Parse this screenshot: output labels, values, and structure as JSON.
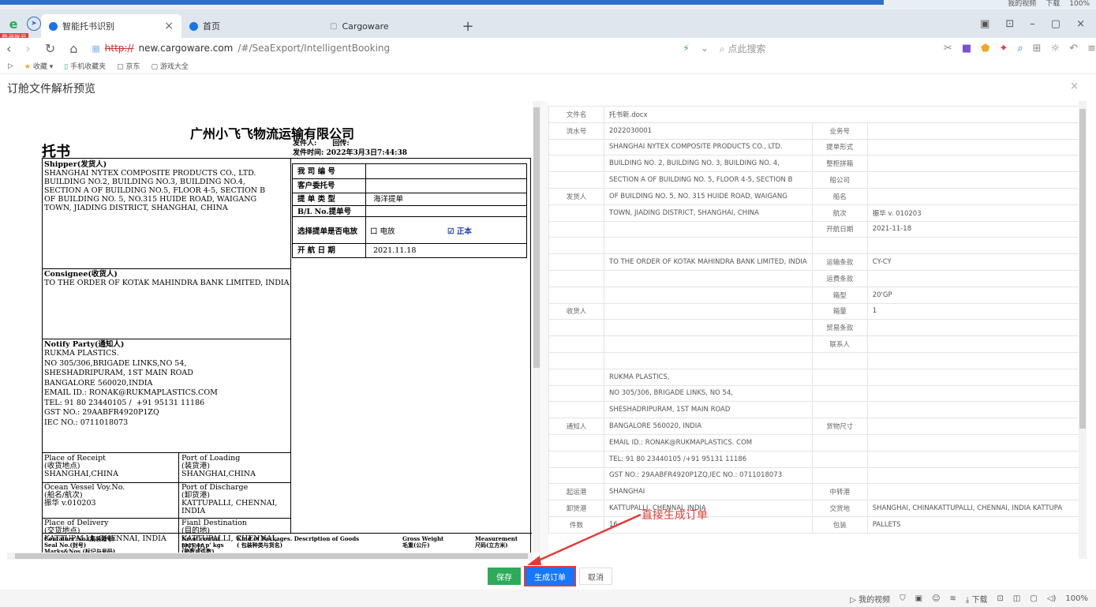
{
  "os": {
    "status_items": [
      "我的视频",
      "下载",
      "100%"
    ]
  },
  "browser": {
    "login_badge": "登录账号",
    "tabs": [
      {
        "label": "智能托书识别",
        "active": true
      },
      {
        "label": "首页",
        "active": false
      },
      {
        "label": "Cargoware",
        "active": false
      }
    ],
    "url_scheme": "http://",
    "url_host": "new.cargoware.com",
    "url_path": "/#/SeaExport/IntelligentBooking",
    "search_placeholder": "点此搜索",
    "bookmarks": [
      "收藏",
      "手机收藏夹",
      "京东",
      "游戏大全"
    ]
  },
  "dialog": {
    "title": "订舱文件解析预览",
    "buttons": {
      "save": "保存",
      "generate": "生成订单",
      "cancel": "取消"
    },
    "annotation": "直接生成订单"
  },
  "document": {
    "company": "广州小飞飞物流运输有限公司",
    "heading": "托书",
    "sender_label": "发件人:",
    "reply_label": "回传:",
    "send_time": "发件时间: 2022年3月3日7:44:38",
    "shipper_label": "Shipper(发货人)",
    "shipper_text": "SHANGHAI NYTEX COMPOSITE PRODUCTS CO., LTD.\nBUILDING NO.2, BUILDING NO.3, BUILDING NO.4,\nSECTION A OF BUILDING NO.5, FLOOR 4-5, SECTION B\nOF BUILDING NO. 5, NO.315 HUIDE ROAD, WAIGANG\nTOWN, JIADING DISTRICT, SHANGHAI, CHINA",
    "company_no": "我 司 编 号",
    "client_no": "客户委托号",
    "bl_type_label": "提 单 类 型",
    "bl_type_value": "海洋提单",
    "bl_no": "B/L No.提单号",
    "telex_label": "选择提单是否电放",
    "telex_opt1": "口 电放",
    "telex_opt2": "☑ 正本",
    "consignee_label": "Consignee(收货人)",
    "consignee_text": "TO THE ORDER OF KOTAK MAHINDRA BANK LIMITED, INDIA",
    "sail_label": "开 航 日 期",
    "sail_value": "2021.11.18",
    "notify_label": "Notify Party(通知人)",
    "notify_text": "RUKMA PLASTICS.\nNO 305/306,BRIGADE LINKS,NO 54,\nSHESHADRIPURAM, 1ST MAIN ROAD\nBANGALORE 560020,INDIA\nEMAIL ID.: RONAK@RUKMAPLASTICS.COM\nTEL: 91 80 23440105 /  +91 95131 11186\nGST NO.: 29AABFR4920P1ZQ\nIEC NO.: 0711018073",
    "receipt": "Place of Receipt\n(收货地点)\nSHANGHAI,CHINA",
    "loading": "Port of Loading\n(装货港)\nSHANGHAI,CHINA",
    "vessel": "Ocean Vessel Voy.No.\n(船名/航次)\n振华 v.010203",
    "discharge": "Port of Discharge\n(卸货港)\nKATTUPALLI, CHENNAI,\nINDIA",
    "delivery": "Place of Delivery\n(交货地点)\nKATTUPALLI, CHENNAI, INDIA",
    "final": "Fianl Destination\n(目的地)\nKATTUPALLI, CHENNAI,\nINDIA",
    "col_container": "Container No.(集装箱号)\nSeal No.(封号)\nMarks&Nos.(标记与号码)",
    "col_packages": "No of contai\nners or p' kgs\n(箱数或件数)",
    "col_kind": "Kind of Packages. Description of Goods\n( 包装种类与货名)",
    "col_weight": "Gross Weight\n毛重(公斤)",
    "col_measure": "Measurement\n尺码(立方米)"
  },
  "form": {
    "rows": [
      {
        "l": "文件名",
        "v": "托书新.docx",
        "l2": "",
        "v2": "",
        "full": true
      },
      {
        "l": "流水号",
        "v": "2022030001",
        "l2": "业务号",
        "v2": ""
      },
      {
        "l": "",
        "v": "SHANGHAI NYTEX COMPOSITE PRODUCTS CO., LTD.",
        "l2": "提单形式",
        "v2": ""
      },
      {
        "l": "",
        "v": "BUILDING NO. 2, BUILDING NO. 3, BUILDING NO. 4,",
        "l2": "整柜拼箱",
        "v2": ""
      },
      {
        "l": "",
        "v": "SECTION A OF BUILDING NO. 5, FLOOR 4-5, SECTION B",
        "l2": "船公司",
        "v2": ""
      },
      {
        "l": "发货人",
        "v": "OF BUILDING NO. 5, NO. 315 HUIDE ROAD, WAIGANG",
        "l2": "船名",
        "v2": ""
      },
      {
        "l": "",
        "v": "TOWN, JIADING DISTRICT, SHANGHAI, CHINA",
        "l2": "航次",
        "v2": "振华 v. 010203"
      },
      {
        "l": "",
        "v": "",
        "l2": "开航日期",
        "v2": "2021-11-18"
      },
      {
        "l": "",
        "v": "",
        "l2": "",
        "v2": ""
      },
      {
        "l": "",
        "v": "TO THE ORDER OF KOTAK MAHINDRA BANK LIMITED, INDIA",
        "l2": "运输条款",
        "v2": "CY-CY"
      },
      {
        "l": "",
        "v": "",
        "l2": "运费条款",
        "v2": ""
      },
      {
        "l": "",
        "v": "",
        "l2": "箱型",
        "v2": "20'GP"
      },
      {
        "l": "收货人",
        "v": "",
        "l2": "箱量",
        "v2": "1"
      },
      {
        "l": "",
        "v": "",
        "l2": "贸易条款",
        "v2": ""
      },
      {
        "l": "",
        "v": "",
        "l2": "联系人",
        "v2": ""
      },
      {
        "l": "",
        "v": "",
        "l2": "",
        "v2": ""
      },
      {
        "l": "",
        "v": "RUKMA PLASTICS,",
        "l2": "",
        "v2": ""
      },
      {
        "l": "",
        "v": "NO 305/306, BRIGADE LINKS, NO 54,",
        "l2": "",
        "v2": ""
      },
      {
        "l": "",
        "v": "SHESHADRIPURAM, 1ST MAIN ROAD",
        "l2": "",
        "v2": ""
      },
      {
        "l": "通知人",
        "v": "BANGALORE 560020, INDIA",
        "l2": "货物尺寸",
        "v2": ""
      },
      {
        "l": "",
        "v": "EMAIL ID.: RONAK@RUKMAPLASTICS. COM",
        "l2": "",
        "v2": ""
      },
      {
        "l": "",
        "v": "TEL: 91 80 23440105 /+91 95131 11186",
        "l2": "",
        "v2": ""
      },
      {
        "l": "",
        "v": "GST NO.: 29AABFR4920P1ZQ,IEC NO.: 0711018073",
        "l2": "",
        "v2": ""
      },
      {
        "l": "起运港",
        "v": "SHANGHAI",
        "l2": "中转港",
        "v2": ""
      },
      {
        "l": "卸货港",
        "v": "KATTUPALLI, CHENNAI, INDIA",
        "l2": "交货地",
        "v2": "SHANGHAI, CHINAKATTUPALLI, CHENNAI, INDIA KATTUPA"
      },
      {
        "l": "件数",
        "v": "16",
        "l2": "包装",
        "v2": "PALLETS"
      }
    ]
  },
  "colors": {
    "save": "#2eaa5a",
    "generate": "#1677ff",
    "annotation": "#e53935"
  }
}
